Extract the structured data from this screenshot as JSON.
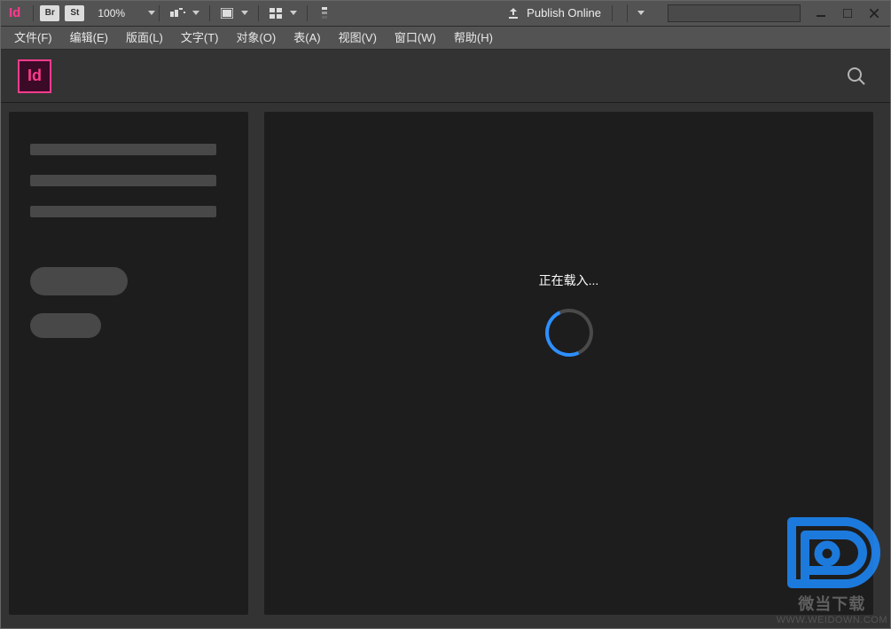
{
  "titleBar": {
    "appLabel": "Id",
    "brIcon": "Br",
    "stIcon": "St",
    "zoomValue": "100%",
    "publishLabel": "Publish Online"
  },
  "menu": {
    "items": [
      "文件(F)",
      "编辑(E)",
      "版面(L)",
      "文字(T)",
      "对象(O)",
      "表(A)",
      "视图(V)",
      "窗口(W)",
      "帮助(H)"
    ]
  },
  "logo": {
    "text": "Id"
  },
  "main": {
    "loadingText": "正在载入..."
  },
  "watermark": {
    "sub": "微当下载",
    "url": "WWW.WEIDOWN.COM"
  }
}
